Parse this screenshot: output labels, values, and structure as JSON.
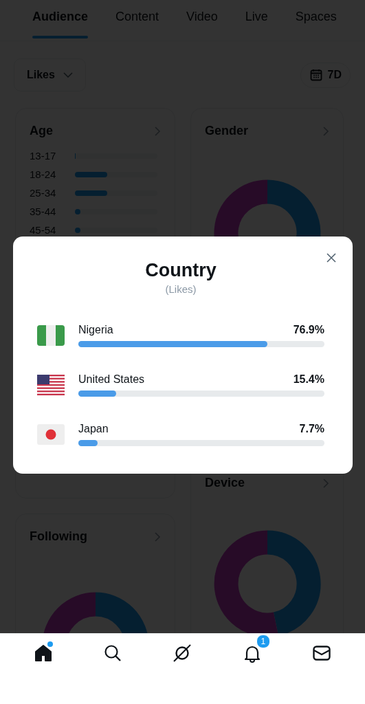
{
  "tabs": [
    {
      "label": "Audience",
      "selected": true
    },
    {
      "label": "Content",
      "selected": false
    },
    {
      "label": "Video",
      "selected": false
    },
    {
      "label": "Live",
      "selected": false
    },
    {
      "label": "Spaces",
      "selected": false
    }
  ],
  "filter": {
    "label": "Likes"
  },
  "date_range": {
    "label": "7D"
  },
  "age_card": {
    "title": "Age",
    "rows": [
      {
        "label": "13-17",
        "level": 0
      },
      {
        "label": "18-24",
        "level": 0.39
      },
      {
        "label": "25-34",
        "level": 0.39
      },
      {
        "label": "35-44",
        "level": 0.07
      },
      {
        "label": "45-54",
        "level": 0.07
      }
    ]
  },
  "gender_card": {
    "title": "Gender"
  },
  "device_card": {
    "title": "Device"
  },
  "following_card": {
    "title": "Following"
  },
  "dialog": {
    "title": "Country",
    "subtitle": "(Likes)",
    "countries": [
      {
        "kind": "nigeria",
        "name": "Nigeria",
        "percent": "76.9%",
        "level": 0.769
      },
      {
        "kind": "usa",
        "name": "United States",
        "percent": "15.4%",
        "level": 0.154
      },
      {
        "kind": "japan",
        "name": "Japan",
        "percent": "7.7%",
        "level": 0.077
      }
    ]
  },
  "nav": [
    {
      "kind": "home",
      "selected": true,
      "dot": true
    },
    {
      "kind": "search",
      "selected": false
    },
    {
      "kind": "grok",
      "selected": false
    },
    {
      "kind": "notifications",
      "selected": false,
      "badge": "1"
    },
    {
      "kind": "messages",
      "selected": false
    }
  ]
}
